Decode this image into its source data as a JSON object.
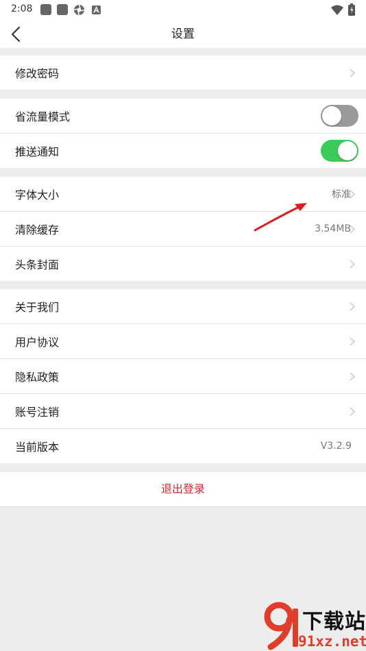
{
  "status_bar": {
    "time": "2:08"
  },
  "header": {
    "title": "设置"
  },
  "groups": {
    "password": {
      "label": "修改密码"
    },
    "traffic": {
      "label": "省流量模式",
      "enabled": false
    },
    "push": {
      "label": "推送通知",
      "enabled": true
    },
    "font_size": {
      "label": "字体大小",
      "value": "标准"
    },
    "cache": {
      "label": "清除缓存",
      "value": "3.54MB"
    },
    "cover": {
      "label": "头条封面"
    },
    "about": {
      "label": "关于我们"
    },
    "agreement": {
      "label": "用户协议"
    },
    "privacy": {
      "label": "隐私政策"
    },
    "cancel_account": {
      "label": "账号注销"
    },
    "version": {
      "label": "当前版本",
      "value": "V3.2.9"
    }
  },
  "logout": {
    "label": "退出登录"
  },
  "watermark": {
    "title": "下载站",
    "url": "91xz.net"
  },
  "colors": {
    "accent_red": "#d0262f",
    "toggle_on": "#3bcb5a",
    "toggle_off": "#9a9a9a",
    "background": "#ededed"
  },
  "icons": {
    "back": "chevron-left-icon",
    "row_arrow": "chevron-right-icon"
  }
}
